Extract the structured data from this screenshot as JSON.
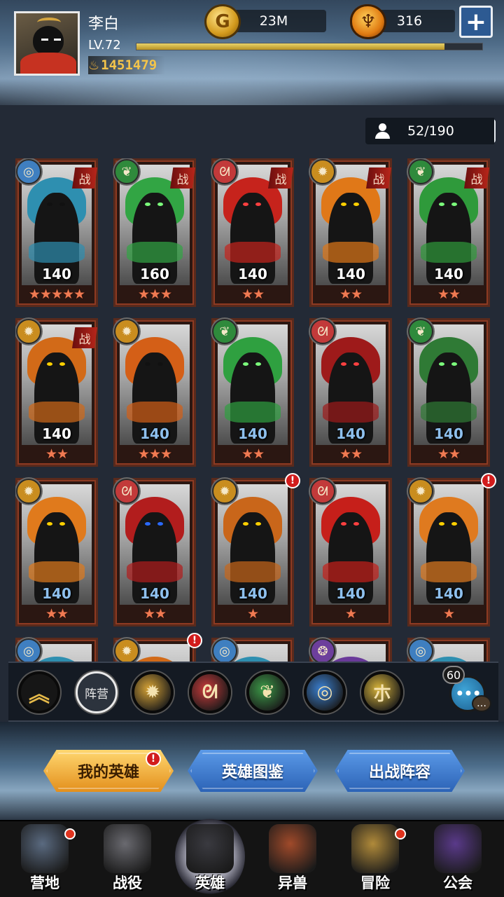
{
  "header": {
    "player_name": "李白",
    "level": "LV.72",
    "xp_fraction": 0.89,
    "power": "1451479",
    "gold": "23M",
    "gems": "316",
    "gold_icon_letter": "G",
    "icons": [
      "avatar",
      "power-icon",
      "gold-coin-icon",
      "gem-icon",
      "plus-icon"
    ]
  },
  "roster": {
    "count": "52/190",
    "plus": "+"
  },
  "heroes": [
    {
      "level": "140",
      "stars": "★★★★★",
      "elem": "water",
      "battle": true,
      "level_color": "white",
      "hair": "#2e8fb0",
      "eyes": "#111"
    },
    {
      "level": "160",
      "stars": "★★★",
      "elem": "wood",
      "battle": true,
      "level_color": "white",
      "hair": "#32a544",
      "eyes": "#7cff7c"
    },
    {
      "level": "140",
      "stars": "★★",
      "elem": "fire",
      "battle": true,
      "level_color": "white",
      "hair": "#c6231c",
      "eyes": "#ff4040"
    },
    {
      "level": "140",
      "stars": "★★",
      "elem": "light",
      "battle": true,
      "level_color": "white",
      "hair": "#e07818",
      "eyes": "#ffd000"
    },
    {
      "level": "140",
      "stars": "★★",
      "elem": "wood",
      "battle": true,
      "level_color": "white",
      "hair": "#2f9a3b",
      "eyes": "#7cff7c"
    },
    {
      "level": "140",
      "stars": "★★",
      "elem": "light",
      "battle": true,
      "level_color": "white",
      "hair": "#d26a18",
      "eyes": "#ffd000"
    },
    {
      "level": "140",
      "stars": "★★★",
      "elem": "light",
      "battle": false,
      "level_color": "blue",
      "hair": "#d45f17",
      "eyes": "#111"
    },
    {
      "level": "140",
      "stars": "★★",
      "elem": "wood",
      "battle": false,
      "level_color": "blue",
      "hair": "#2fa040",
      "eyes": "#7cff7c"
    },
    {
      "level": "140",
      "stars": "★★",
      "elem": "fire",
      "battle": false,
      "level_color": "blue",
      "hair": "#9e1a1a",
      "eyes": "#ff4040"
    },
    {
      "level": "140",
      "stars": "★★",
      "elem": "wood",
      "battle": false,
      "level_color": "blue",
      "hair": "#2f7a35",
      "eyes": "#7cff7c"
    },
    {
      "level": "140",
      "stars": "★★",
      "elem": "light",
      "battle": false,
      "level_color": "blue",
      "hair": "#e07a1c",
      "eyes": "#ffd000"
    },
    {
      "level": "140",
      "stars": "★★",
      "elem": "fire",
      "battle": false,
      "level_color": "blue",
      "hair": "#b21d1d",
      "eyes": "#2a6aff"
    },
    {
      "level": "140",
      "stars": "★",
      "elem": "light",
      "battle": false,
      "level_color": "blue",
      "hair": "#c9661a",
      "eyes": "#ffd000",
      "alert": true
    },
    {
      "level": "140",
      "stars": "★",
      "elem": "fire",
      "battle": false,
      "level_color": "blue",
      "hair": "#c61f1a",
      "eyes": "#ff4040"
    },
    {
      "level": "140",
      "stars": "★",
      "elem": "light",
      "battle": false,
      "level_color": "blue",
      "hair": "#df7a1f",
      "eyes": "#ffd000",
      "alert": true
    },
    {
      "level": "",
      "stars": "",
      "elem": "water",
      "battle": false,
      "level_color": "blue",
      "hair": "#2e8fb0",
      "eyes": "#111"
    },
    {
      "level": "",
      "stars": "",
      "elem": "light",
      "battle": false,
      "level_color": "blue",
      "hair": "#d26a18",
      "eyes": "#111",
      "alert": true
    },
    {
      "level": "",
      "stars": "",
      "elem": "water",
      "battle": false,
      "level_color": "blue",
      "hair": "#2e8fb0",
      "eyes": "#111"
    },
    {
      "level": "",
      "stars": "",
      "elem": "dark",
      "battle": false,
      "level_color": "blue",
      "hair": "#6a3a9a",
      "eyes": "#111"
    },
    {
      "level": "",
      "stars": "",
      "elem": "water",
      "battle": false,
      "level_color": "blue",
      "hair": "#2e8fb0",
      "eyes": "#111"
    }
  ],
  "hero_battle_label": "战",
  "hero_alert_label": "!",
  "element_colors": {
    "water": "#3f7fc0",
    "wood": "#2f8a3c",
    "fire": "#c23a3a",
    "light": "#c98d1f",
    "dark": "#6d3f9c"
  },
  "filters": {
    "collapse_icon": "︽",
    "camp_label": "阵营",
    "items": [
      {
        "name": "light-filter",
        "glyph": "✹",
        "color": "#d8a436"
      },
      {
        "name": "fire-filter",
        "glyph": "ᘛ",
        "color": "#c83a3a"
      },
      {
        "name": "wood-filter",
        "glyph": "❦",
        "color": "#3c9a48"
      },
      {
        "name": "water-filter",
        "glyph": "◎",
        "color": "#3a7fd0"
      },
      {
        "name": "special-filter",
        "glyph": "朩",
        "color": "#d8b43a"
      }
    ]
  },
  "chat": {
    "count": "60",
    "dots": "•••"
  },
  "tabs": {
    "my_heroes": "我的英雄",
    "hero_guide": "英雄图鉴",
    "battle_lineup": "出战阵容",
    "alert": "!"
  },
  "nav": [
    {
      "label": "营地",
      "icon": "camp-icon",
      "dot": true,
      "color": "#5a6a80"
    },
    {
      "label": "战役",
      "icon": "crossed-swords-icon",
      "dot": false,
      "color": "#6a6a70"
    },
    {
      "label": "英雄",
      "icon": "knight-helmet-icon",
      "dot": false,
      "color": "#3a3a40",
      "active": true
    },
    {
      "label": "异兽",
      "icon": "beast-icon",
      "dot": false,
      "color": "#a04a2a"
    },
    {
      "label": "冒险",
      "icon": "compass-icon",
      "dot": true,
      "color": "#b08a3a"
    },
    {
      "label": "公会",
      "icon": "guild-banner-icon",
      "dot": false,
      "color": "#5a3a8a"
    }
  ]
}
